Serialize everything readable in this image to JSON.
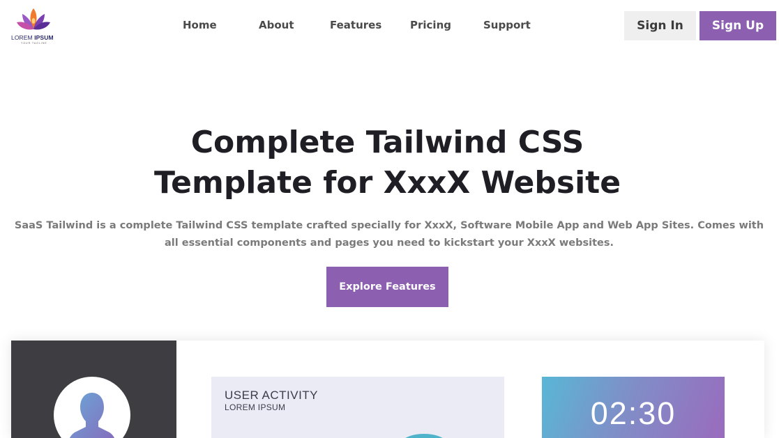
{
  "brand": {
    "name_light": "LOREM",
    "name_bold": "IPSUM",
    "tagline": "YOUR TAGLINE",
    "colors": {
      "primary": "#8c5fb0",
      "orange": "#f07a2e",
      "navy": "#2a2a6e"
    }
  },
  "nav": {
    "items": [
      {
        "label": "Home"
      },
      {
        "label": "About"
      },
      {
        "label": "Features"
      },
      {
        "label": "Pricing"
      },
      {
        "label": "Support"
      }
    ]
  },
  "auth": {
    "sign_in": "Sign In",
    "sign_up": "Sign Up"
  },
  "hero": {
    "title_line1": "Complete Tailwind CSS",
    "title_line2": "Template for XxxX Website",
    "subtitle": "SaaS Tailwind is a complete Tailwind CSS template crafted specially for XxxX, Software Mobile App and Web App Sites. Comes with all essential components and pages you need to kickstart your XxxX websites.",
    "cta": "Explore Features"
  },
  "preview": {
    "profile_icon": "user-avatar-icon",
    "activity": {
      "title": "USER ACTIVITY",
      "subtitle": "LOREM IPSUM"
    },
    "timer": {
      "value": "02:30"
    }
  }
}
